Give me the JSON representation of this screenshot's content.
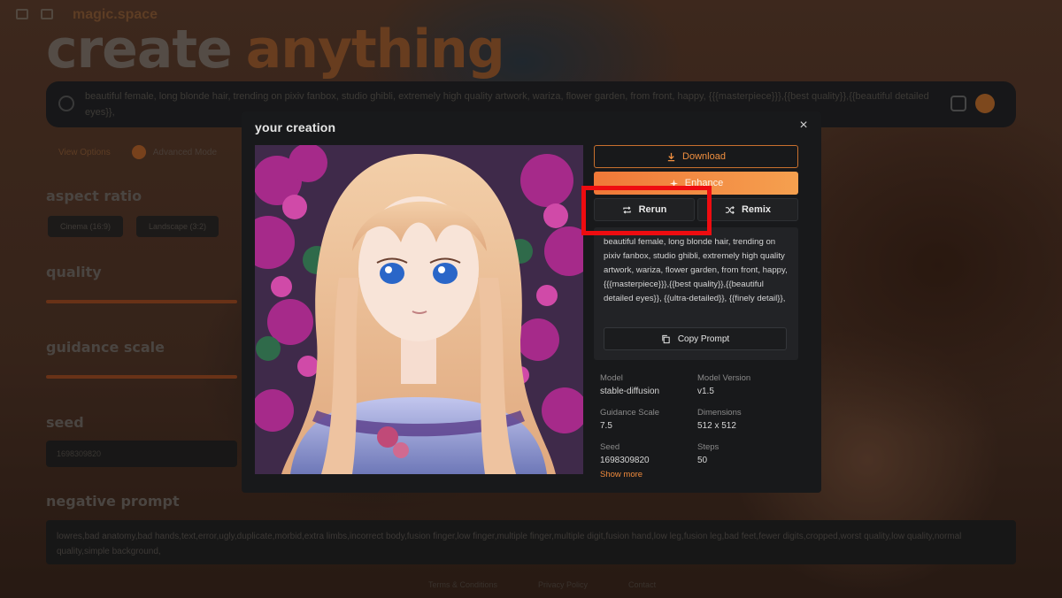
{
  "background": {
    "brand": "magic.space",
    "headline_word1": "create",
    "headline_word2": "anything",
    "search_text": "beautiful female, long blonde hair, trending on pixiv fanbox, studio ghibli, extremely high quality artwork, wariza, flower garden, from front, happy, {{{masterpiece}}},{{best quality}},{{beautiful detailed eyes}},",
    "view_options": "View Options",
    "advanced_mode": "Advanced Mode",
    "aspect_ratio_label": "aspect ratio",
    "aspect_options": [
      "Cinema (16:9)",
      "Landscape (3:2)"
    ],
    "quality_label": "quality",
    "guidance_label": "guidance scale",
    "seed_label": "seed",
    "seed_value": "1698309820",
    "negative_label": "negative prompt",
    "negative_text": "lowres,bad anatomy,bad hands,text,error,ugly,duplicate,morbid,extra limbs,incorrect body,fusion finger,low finger,multiple finger,multiple digit,fusion hand,low leg,fusion leg,bad feet,fewer digits,cropped,worst quality,low quality,normal quality,simple background,",
    "footer": [
      "Terms & Conditions",
      "Privacy Policy",
      "Contact"
    ]
  },
  "modal": {
    "title": "your creation",
    "close_icon": "close-icon",
    "image_alt": "anime girl with long blonde hair in a flower garden",
    "buttons": {
      "download": "Download",
      "enhance": "Enhance",
      "rerun": "Rerun",
      "remix": "Remix",
      "copy_prompt": "Copy Prompt"
    },
    "prompt": "beautiful female, long blonde hair, trending on pixiv fanbox, studio ghibli, extremely high quality artwork, wariza, flower garden, from front, happy, {{{masterpiece}}},{{best quality}},{{beautiful detailed eyes}}, {{ultra-detailed}}, {{finely detail}},",
    "meta": [
      {
        "label": "Model",
        "value": "stable-diffusion"
      },
      {
        "label": "Model Version",
        "value": "v1.5"
      },
      {
        "label": "Guidance Scale",
        "value": "7.5"
      },
      {
        "label": "Dimensions",
        "value": "512 x 512"
      },
      {
        "label": "Seed",
        "value": "1698309820"
      },
      {
        "label": "Steps",
        "value": "50"
      }
    ],
    "show_more": "Show more"
  },
  "colors": {
    "accent": "#f08a3c",
    "highlight": "#ee0c10",
    "modal_bg": "#18191b"
  }
}
